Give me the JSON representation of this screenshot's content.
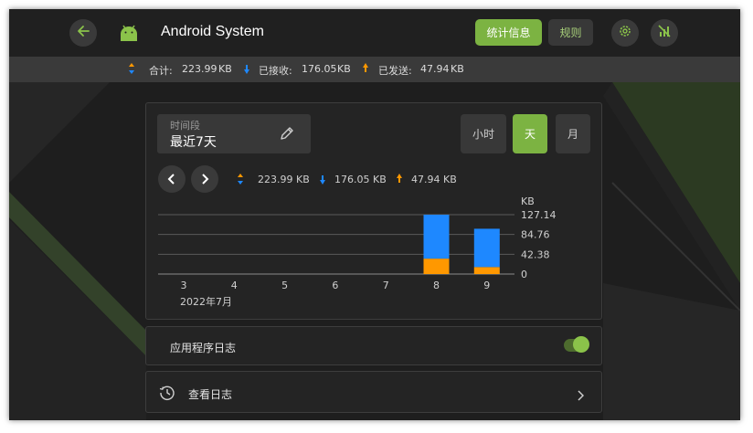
{
  "header": {
    "back_icon": "arrow-left-icon",
    "app_icon": "android-icon",
    "app_title": "Android System",
    "tabs": [
      {
        "label": "统计信息",
        "active": true
      },
      {
        "label": "规则",
        "active": false
      }
    ],
    "settings_icon": "gear-icon",
    "network_off_icon": "signal-off-icon"
  },
  "summary": {
    "total_label": "合计:",
    "total_value": "223.99",
    "total_unit": "KB",
    "received_label": "已接收:",
    "received_value": "176.05",
    "received_unit": "KB",
    "sent_label": "已发送:",
    "sent_value": "47.94",
    "sent_unit": "KB"
  },
  "period": {
    "label": "时间段",
    "value": "最近7天",
    "edit_icon": "pencil-icon"
  },
  "granularity": [
    {
      "label": "小时",
      "active": false
    },
    {
      "label": "天",
      "active": true
    },
    {
      "label": "月",
      "active": false
    }
  ],
  "legend": {
    "total": "223.99 KB",
    "received": "176.05 KB",
    "sent": "47.94 KB"
  },
  "colors": {
    "accent": "#7cb342",
    "received": "#1e88ff",
    "sent": "#ff9800"
  },
  "chart_data": {
    "type": "bar",
    "stacked": true,
    "categories": [
      "3",
      "4",
      "5",
      "6",
      "7",
      "8",
      "9"
    ],
    "x_sublabel": "2022年7月",
    "series": [
      {
        "name": "已接收",
        "values": [
          0,
          0,
          0,
          0,
          0,
          94,
          82
        ]
      },
      {
        "name": "已发送",
        "values": [
          0,
          0,
          0,
          0,
          0,
          33,
          15
        ]
      }
    ],
    "y_unit": "KB",
    "y_ticks": [
      "127.14",
      "84.76",
      "42.38",
      "0"
    ],
    "ylim": [
      0,
      127.14
    ],
    "grid": true,
    "y_axis_side": "right"
  },
  "app_log": {
    "label": "应用程序日志",
    "enabled": true
  },
  "view_log": {
    "icon": "history-icon",
    "label": "查看日志",
    "chevron_icon": "chevron-right-icon"
  }
}
